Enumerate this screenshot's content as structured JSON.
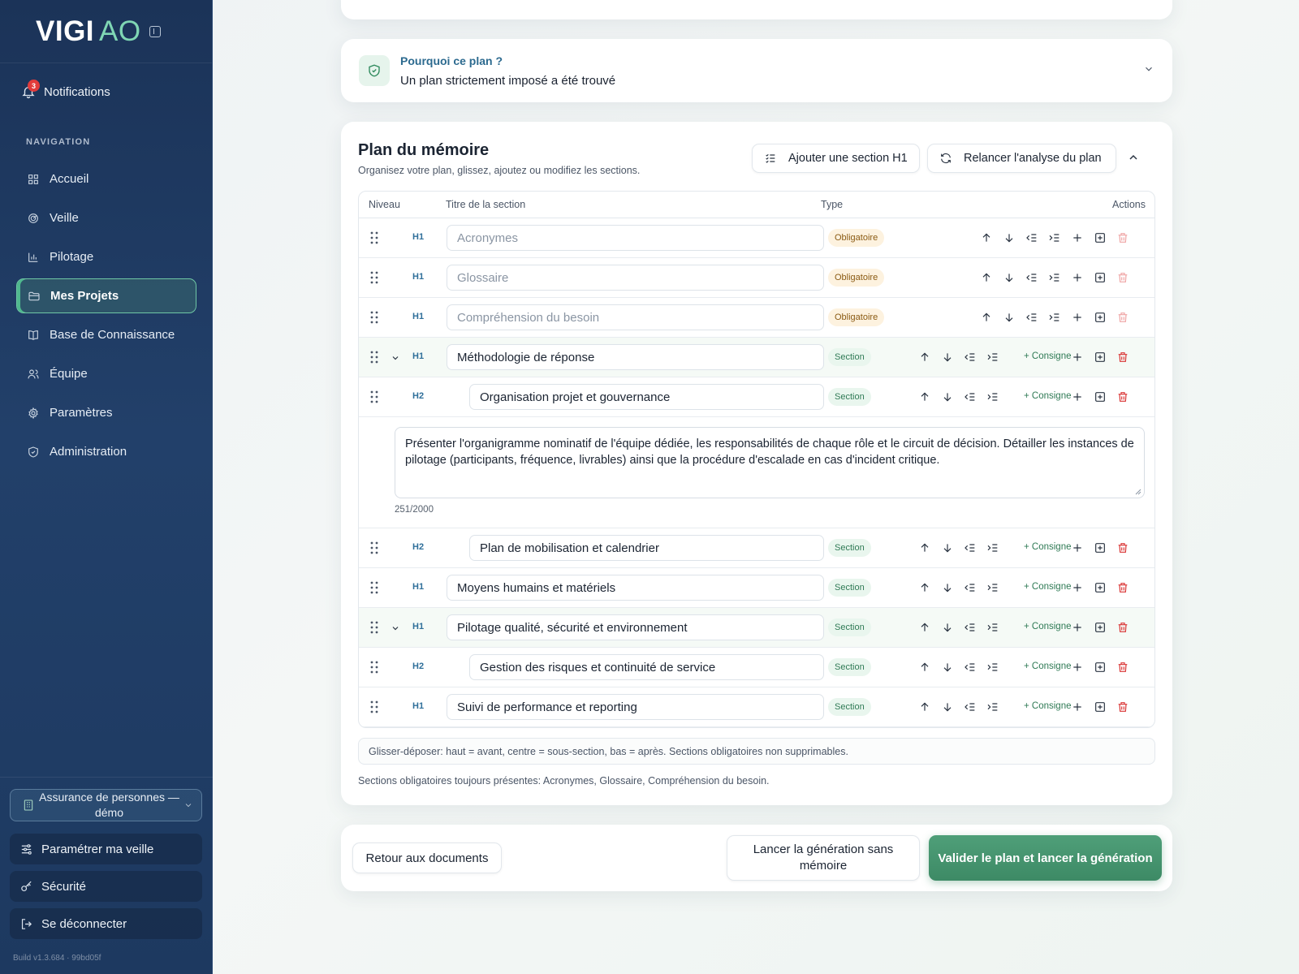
{
  "sidebar": {
    "logo_main": "VIGI",
    "logo_accent": "AO",
    "notifications": {
      "label": "Notifications",
      "count": "3"
    },
    "nav_title": "NAVIGATION",
    "items": [
      {
        "label": "Accueil",
        "icon": "grid-icon"
      },
      {
        "label": "Veille",
        "icon": "radar-icon"
      },
      {
        "label": "Pilotage",
        "icon": "bar-chart-icon"
      },
      {
        "label": "Mes Projets",
        "icon": "folder-icon",
        "active": true
      },
      {
        "label": "Base de Connaissance",
        "icon": "book-icon"
      },
      {
        "label": "Équipe",
        "icon": "users-icon"
      },
      {
        "label": "Paramètres",
        "icon": "gear-icon"
      },
      {
        "label": "Administration",
        "icon": "shield-icon"
      }
    ],
    "org_select": "Assurance de personnes — démo",
    "bottom": {
      "settings_watch": "Paramétrer ma veille",
      "security": "Sécurité",
      "logout": "Se déconnecter"
    },
    "build": "Build v1.3.684 · 99bd05f"
  },
  "why": {
    "title": "Pourquoi ce plan ?",
    "subtitle": "Un plan strictement imposé a été trouvé"
  },
  "plan": {
    "title": "Plan du mémoire",
    "subtitle": "Organisez votre plan, glissez, ajoutez ou modifiez les sections.",
    "add_button": "Ajouter une section H1",
    "relaunch_button": "Relancer l'analyse du plan",
    "columns": {
      "level": "Niveau",
      "title": "Titre de la section",
      "type": "Type",
      "actions": "Actions"
    },
    "consigne_label": "+ Consigne",
    "rows": [
      {
        "level": "H1",
        "title": "Acronymes",
        "type": "Obligatoire"
      },
      {
        "level": "H1",
        "title": "Glossaire",
        "type": "Obligatoire"
      },
      {
        "level": "H1",
        "title": "Compréhension du besoin",
        "type": "Obligatoire"
      },
      {
        "level": "H1",
        "title": "Méthodologie de réponse",
        "type": "Section"
      },
      {
        "level": "H2",
        "title": "Organisation projet et gouvernance",
        "type": "Section"
      },
      {
        "level": "H2",
        "title": "Plan de mobilisation et calendrier",
        "type": "Section"
      },
      {
        "level": "H1",
        "title": "Moyens humains et matériels",
        "type": "Section"
      },
      {
        "level": "H1",
        "title": "Pilotage qualité, sécurité et environnement",
        "type": "Section"
      },
      {
        "level": "H2",
        "title": "Gestion des risques et continuité de service",
        "type": "Section"
      },
      {
        "level": "H1",
        "title": "Suivi de performance et reporting",
        "type": "Section"
      }
    ],
    "note": {
      "text": "Présenter l'organigramme nominatif de l'équipe dédiée, les responsabilités de chaque rôle et le circuit de décision. Détailler les instances de pilotage (participants, fréquence, livrables) ainsi que la procédure d'escalade en cas d'incident critique.",
      "count": "251/2000"
    },
    "hint": "Glisser-déposer: haut = avant, centre = sous-section, bas = après. Sections obligatoires non supprimables.",
    "mandatory_note": "Sections obligatoires toujours présentes: Acronymes, Glossaire, Compréhension du besoin."
  },
  "footer": {
    "back": "Retour aux documents",
    "no_memory": "Lancer la génération sans mémoire",
    "validate": "Valider le plan et lancer la génération"
  },
  "colors": {
    "accent": "#3d8a65",
    "sidebar": "#1b3358",
    "danger": "#d93434"
  }
}
